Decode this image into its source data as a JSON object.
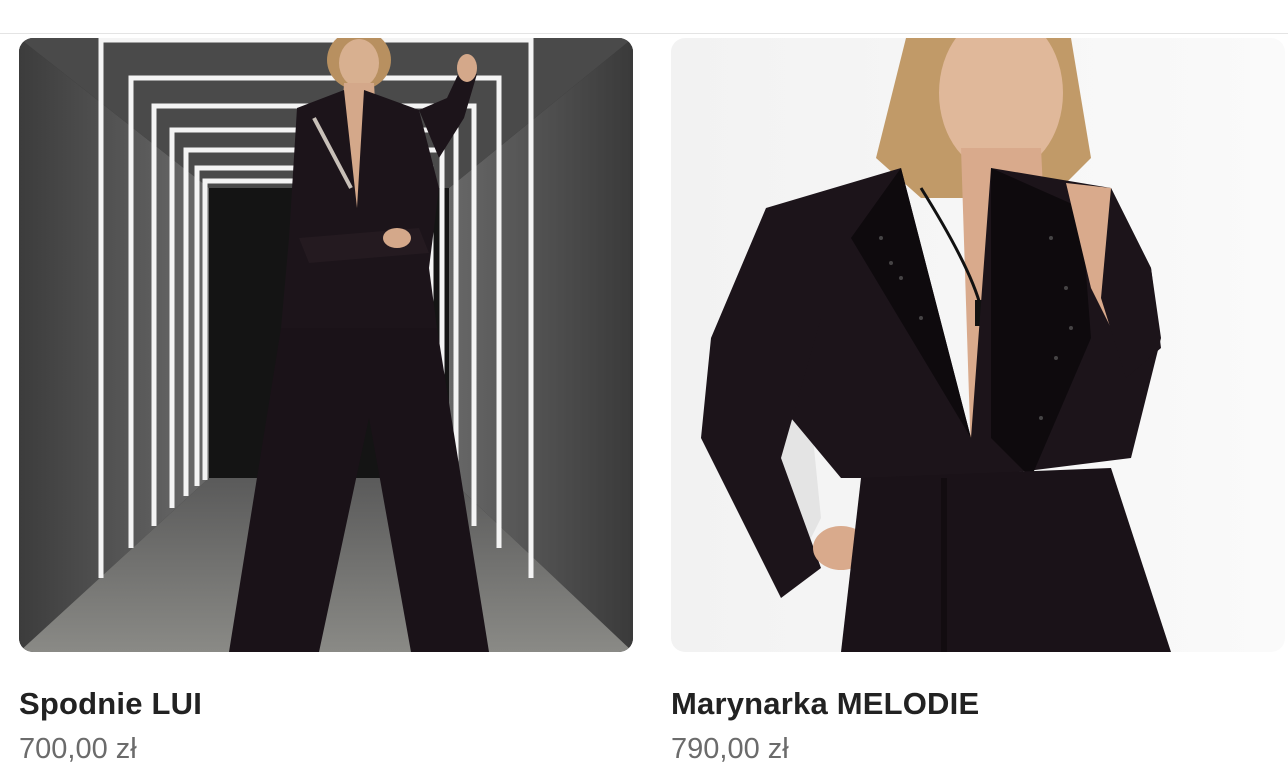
{
  "products": [
    {
      "name": "Spodnie LUI",
      "price": "700,00 zł",
      "image_icon": "product-photo-suit-tunnel"
    },
    {
      "name": "Marynarka MELODIE",
      "price": "790,00 zł",
      "image_icon": "product-photo-cropped-blazer"
    }
  ],
  "colors": {
    "name_text": "#222222",
    "price_text": "#6b6b6b",
    "garment": "#1c141a"
  }
}
